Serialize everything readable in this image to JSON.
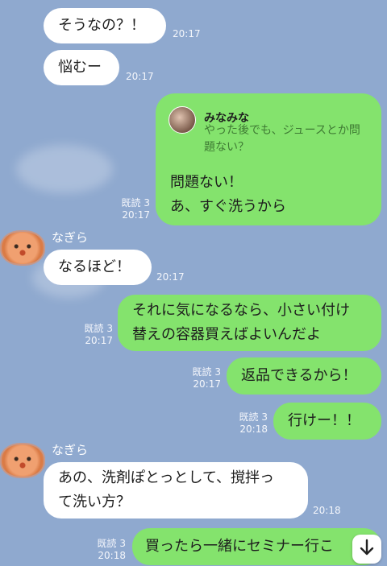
{
  "messages": [
    {
      "side": "in",
      "text": "そうなの？！",
      "time": "20:17"
    },
    {
      "side": "in",
      "text": "悩むー",
      "time": "20:17"
    },
    {
      "side": "out",
      "reply": {
        "name": "みなみな",
        "text": "やった後でも、ジュースとか問題ない？"
      },
      "lines": [
        "問題ない！",
        "あ、すぐ洗うから"
      ],
      "read": "既読 3",
      "time": "20:17"
    },
    {
      "side": "in",
      "sender": "なぎら",
      "text": "なるほど！",
      "time": "20:17"
    },
    {
      "side": "out",
      "lines": [
        "それに気になるなら、小さい付け",
        "替えの容器買えばよいんだよ"
      ],
      "read": "既読 3",
      "time": "20:17"
    },
    {
      "side": "out",
      "text": "返品できるから！",
      "read": "既読 3",
      "time": "20:17"
    },
    {
      "side": "out",
      "text": "行けー！！",
      "read": "既読 3",
      "time": "20:18"
    },
    {
      "side": "in",
      "sender": "なぎら",
      "lines": [
        "あの、洗剤ぽとっとして、撹拌っ",
        "て洗い方？"
      ],
      "time": "20:18"
    },
    {
      "side": "out",
      "text": "買ったら一緒にセミナー行こ",
      "read": "既読 3",
      "time": "20:18"
    }
  ],
  "scroll_button": {
    "icon": "arrow-down-icon"
  },
  "colors": {
    "background": "#8fa9cf",
    "outgoing": "#84e36d",
    "incoming": "#ffffff"
  }
}
